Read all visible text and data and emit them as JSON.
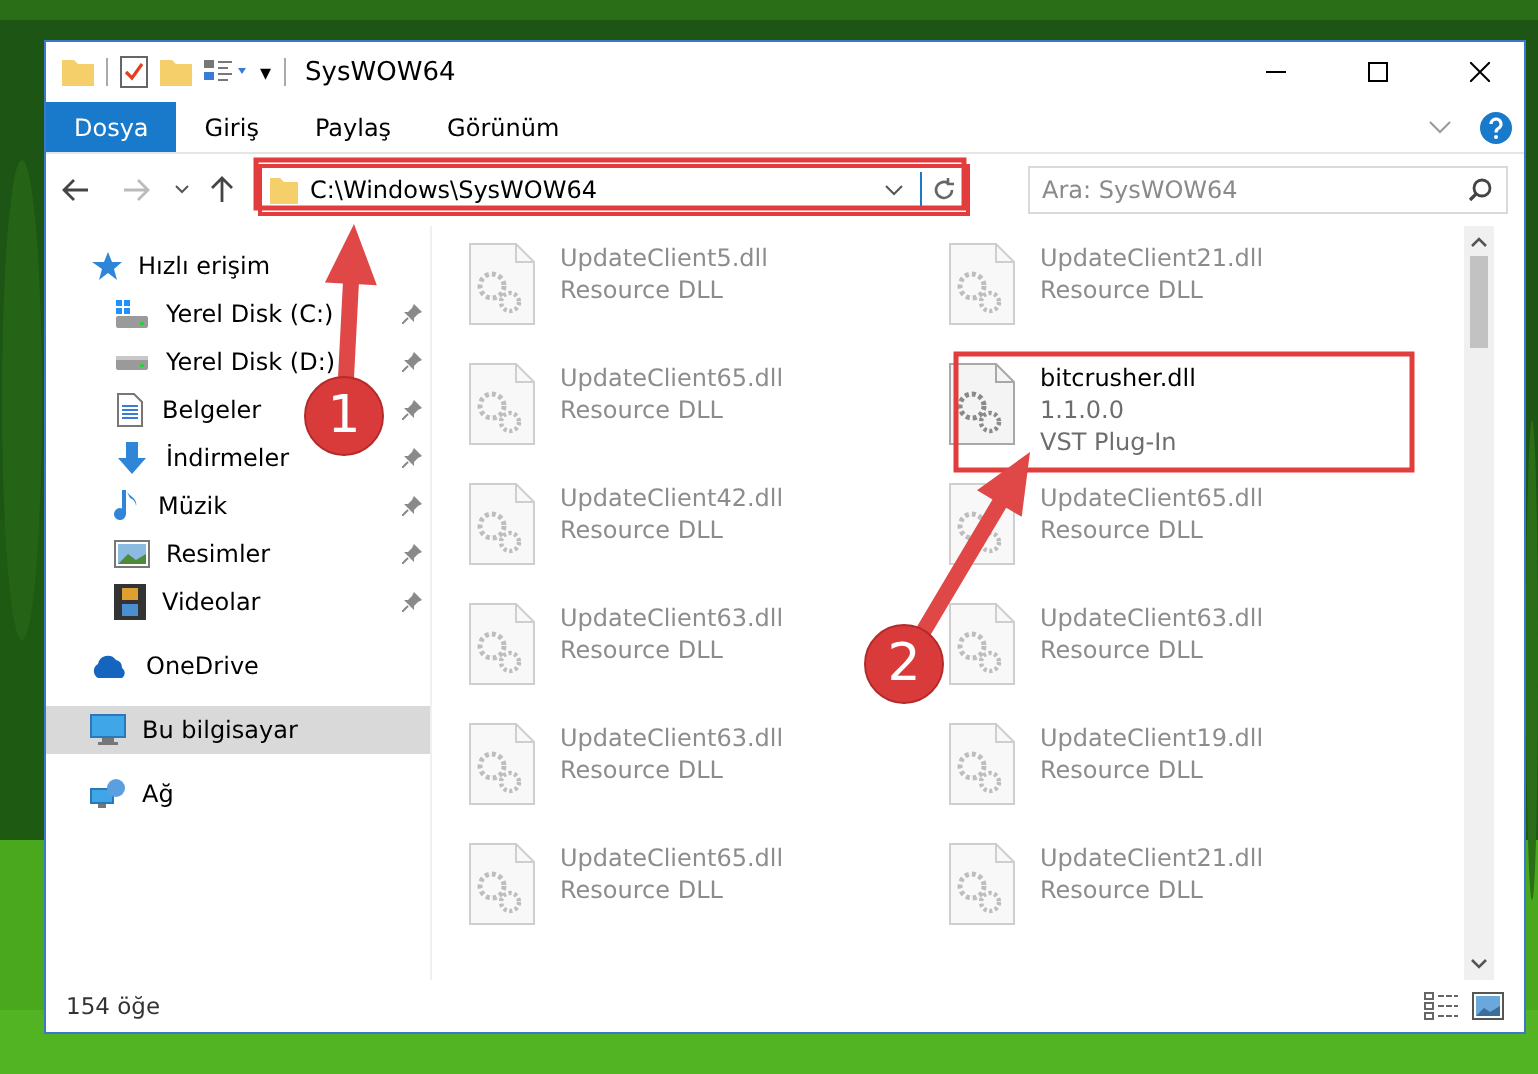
{
  "window": {
    "title": "SysWOW64",
    "quick_access_arrow": "▾"
  },
  "ribbon": {
    "tabs": [
      {
        "label": "Dosya",
        "kind": "file"
      },
      {
        "label": "Giriş",
        "kind": "tab"
      },
      {
        "label": "Paylaş",
        "kind": "tab"
      },
      {
        "label": "Görünüm",
        "kind": "tab"
      }
    ]
  },
  "address_bar": {
    "path": "C:\\Windows\\SysWOW64"
  },
  "search": {
    "placeholder": "Ara: SysWOW64"
  },
  "sidebar": {
    "items": [
      {
        "label": "Hızlı erişim",
        "kind": "quickaccess",
        "selected": false,
        "children": [
          {
            "label": "Yerel Disk (C:)",
            "kind": "systemdrive",
            "pinned": true,
            "selected": false
          },
          {
            "label": "Yerel Disk (D:)",
            "kind": "drive",
            "pinned": true,
            "selected": false
          },
          {
            "label": "Belgeler",
            "kind": "documents",
            "pinned": true,
            "selected": false
          },
          {
            "label": "İndirmeler",
            "kind": "downloads",
            "pinned": true,
            "selected": false
          },
          {
            "label": "Müzik",
            "kind": "music",
            "pinned": true,
            "selected": false
          },
          {
            "label": "Resimler",
            "kind": "pictures",
            "pinned": true,
            "selected": false
          },
          {
            "label": "Videolar",
            "kind": "videos",
            "pinned": true,
            "selected": false
          }
        ]
      },
      {
        "label": "OneDrive",
        "kind": "cloud",
        "selected": false
      },
      {
        "label": "Bu bilgisayar",
        "kind": "computer",
        "selected": true
      },
      {
        "label": "Ağ",
        "kind": "network",
        "selected": false
      }
    ]
  },
  "files": [
    {
      "name": "UpdateClient5.dll",
      "lines": [
        "Resource DLL"
      ],
      "blurred": true
    },
    {
      "name": "UpdateClient21.dll",
      "lines": [
        "Resource DLL"
      ],
      "blurred": true
    },
    {
      "name": "UpdateClient65.dll",
      "lines": [
        "Resource DLL"
      ],
      "blurred": true
    },
    {
      "name": "bitcrusher.dll",
      "lines": [
        "1.1.0.0",
        "VST Plug-In"
      ],
      "blurred": false
    },
    {
      "name": "UpdateClient42.dll",
      "lines": [
        "Resource DLL"
      ],
      "blurred": true
    },
    {
      "name": "UpdateClient65.dll",
      "lines": [
        "Resource DLL"
      ],
      "blurred": true
    },
    {
      "name": "UpdateClient63.dll",
      "lines": [
        "Resource DLL"
      ],
      "blurred": true
    },
    {
      "name": "UpdateClient63.dll",
      "lines": [
        "Resource DLL"
      ],
      "blurred": true
    },
    {
      "name": "UpdateClient63.dll",
      "lines": [
        "Resource DLL"
      ],
      "blurred": true
    },
    {
      "name": "UpdateClient19.dll",
      "lines": [
        "Resource DLL"
      ],
      "blurred": true
    },
    {
      "name": "UpdateClient65.dll",
      "lines": [
        "Resource DLL"
      ],
      "blurred": true
    },
    {
      "name": "UpdateClient21.dll",
      "lines": [
        "Resource DLL"
      ],
      "blurred": true
    }
  ],
  "status_bar": {
    "count": "154 öğe"
  },
  "annotations": [
    {
      "number": "1"
    },
    {
      "number": "2"
    }
  ]
}
